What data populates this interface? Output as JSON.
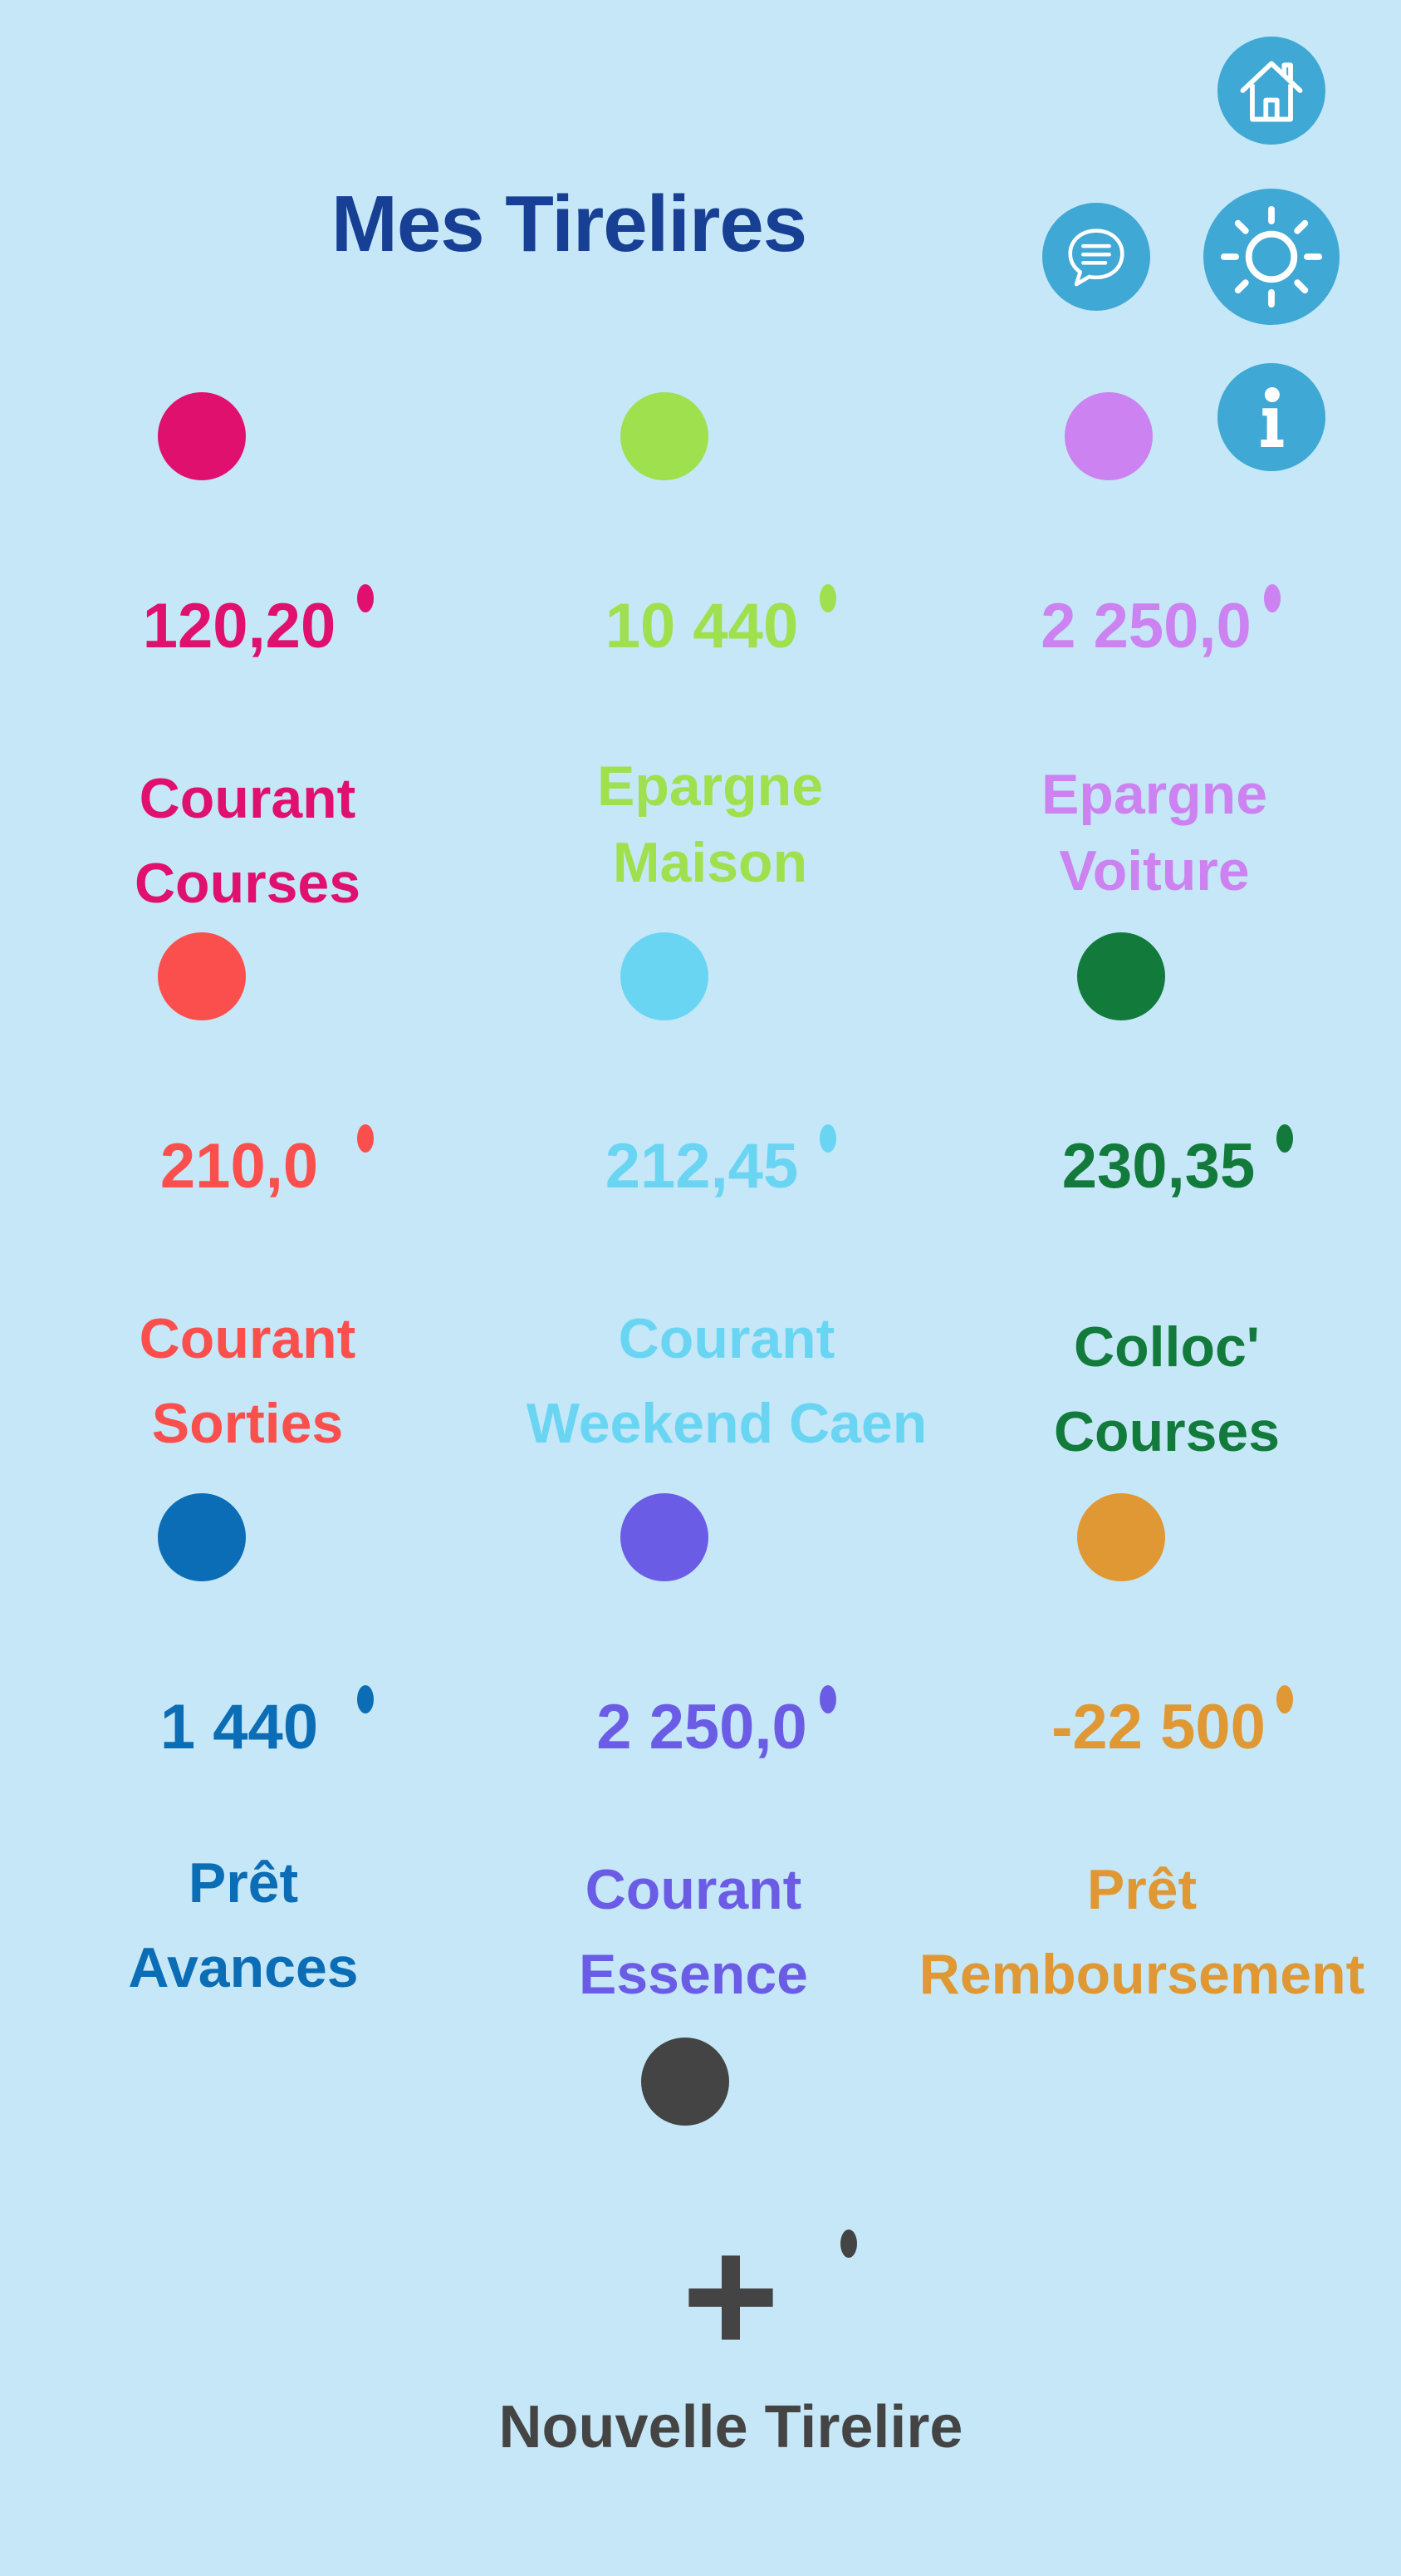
{
  "header": {
    "title": "Mes Tirelires"
  },
  "toolbar": {
    "home_icon": "home-icon",
    "messages_icon": "chat-icon",
    "theme_icon": "sun-icon",
    "info_icon": "info-icon",
    "accent_color": "#3fa8d4"
  },
  "piggy_banks": [
    {
      "balance": "120,20",
      "type": "Courant",
      "name": "Courses",
      "color": "#e0106e"
    },
    {
      "balance": "10 440",
      "type": "Epargne",
      "name": "Maison",
      "color": "#9ee04e"
    },
    {
      "balance": "2 250,0",
      "type": "Epargne",
      "name": "Voiture",
      "color": "#cc82f0"
    },
    {
      "balance": "210,0",
      "type": "Courant",
      "name": "Sorties",
      "color": "#fb4f4d"
    },
    {
      "balance": "212,45",
      "type": "Courant",
      "name": "Weekend Caen",
      "color": "#6ad5f3"
    },
    {
      "balance": "230,35",
      "type": "Colloc'",
      "name": "Courses",
      "color": "#127a3b"
    },
    {
      "balance": "1 440",
      "type": "Prêt",
      "name": "Avances",
      "color": "#0b6db5"
    },
    {
      "balance": "2 250,0",
      "type": "Courant",
      "name": "Essence",
      "color": "#6b5ce6"
    },
    {
      "balance": "-22 500",
      "type": "Prêt",
      "name": "Remboursement",
      "color": "#df9834"
    }
  ],
  "new_piggy": {
    "label": "Nouvelle Tirelire",
    "icon": "plus-icon",
    "color": "#444444"
  }
}
